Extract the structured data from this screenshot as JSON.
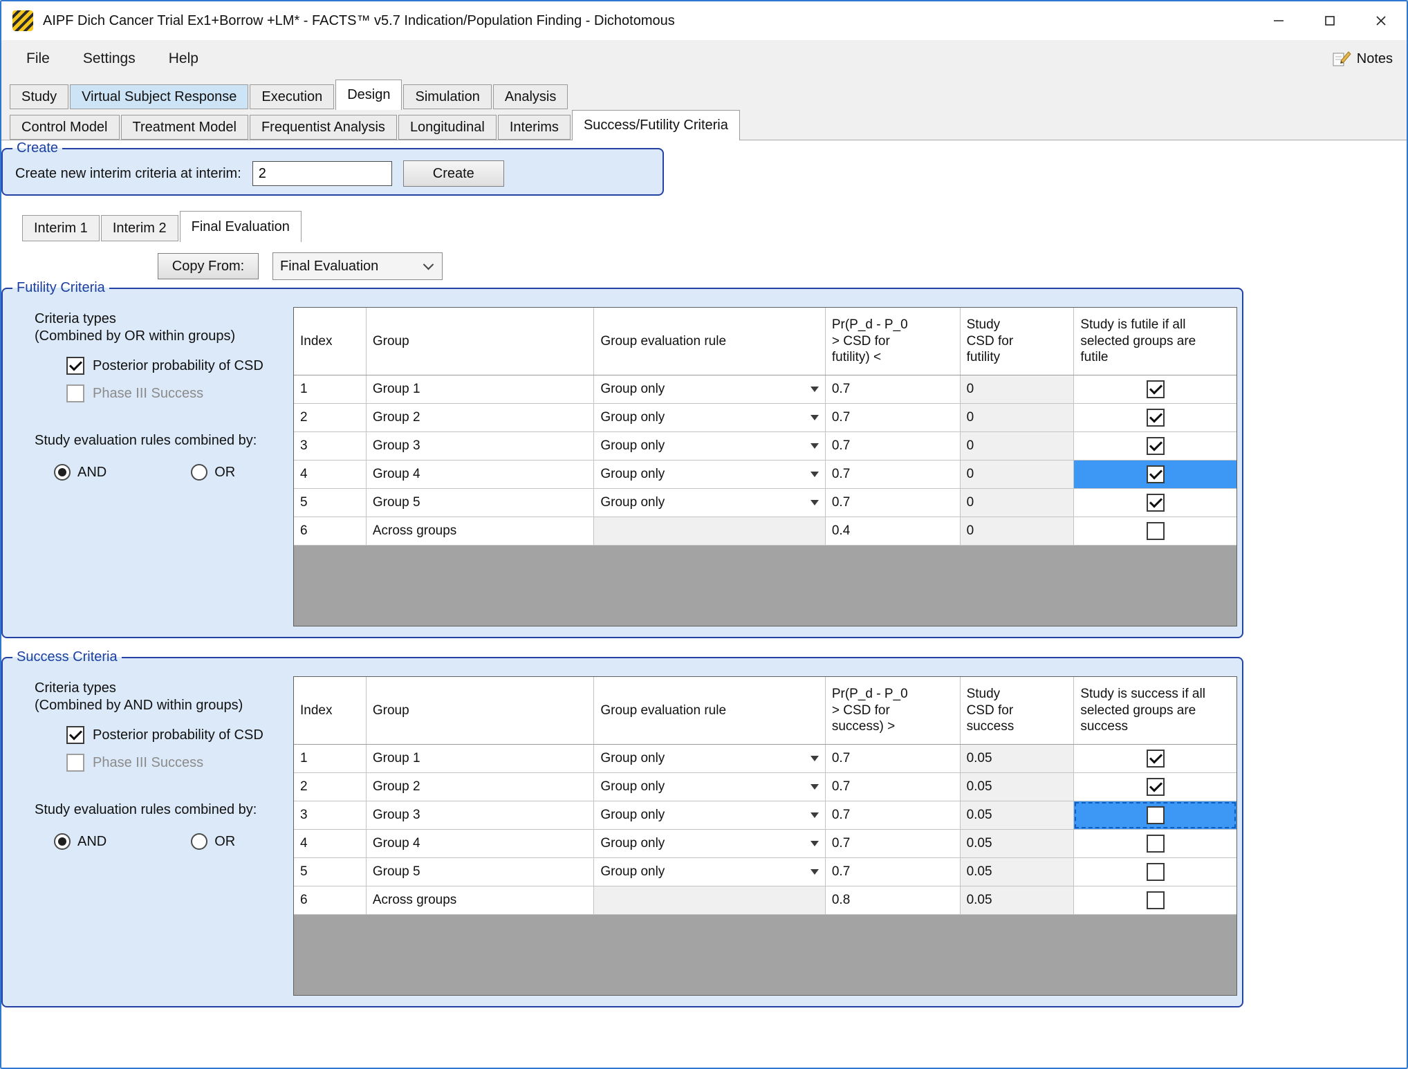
{
  "colors": {
    "window_border": "#2f77d1",
    "groupbox_border": "#2442a4",
    "groupbox_bg": "#dce9f8",
    "legend_text": "#1b3f9e",
    "highlight_blue": "#3d97f5",
    "tab_highlight_bg": "#cde4f7",
    "grid_filler": "#a3a3a3"
  },
  "window": {
    "title": "AIPF Dich Cancer Trial Ex1+Borrow +LM* - FACTS™ v5.7 Indication/Population Finding - Dichotomous"
  },
  "menu": {
    "items": [
      {
        "label": "File"
      },
      {
        "label": "Settings"
      },
      {
        "label": "Help"
      }
    ],
    "notes_label": "Notes"
  },
  "main_tabs": [
    {
      "label": "Study"
    },
    {
      "label": "Virtual Subject Response",
      "highlight": true
    },
    {
      "label": "Execution"
    },
    {
      "label": "Design",
      "selected": true
    },
    {
      "label": "Simulation"
    },
    {
      "label": "Analysis"
    }
  ],
  "design_tabs": [
    {
      "label": "Control Model"
    },
    {
      "label": "Treatment Model"
    },
    {
      "label": "Frequentist Analysis"
    },
    {
      "label": "Longitudinal"
    },
    {
      "label": "Interims"
    },
    {
      "label": "Success/Futility Criteria",
      "selected": true
    }
  ],
  "create": {
    "legend": "Create",
    "label": "Create new interim criteria at interim:",
    "value": "2",
    "button_label": "Create"
  },
  "interim_tabs": [
    {
      "label": "Interim 1"
    },
    {
      "label": "Interim 2"
    },
    {
      "label": "Final Evaluation",
      "selected": true
    }
  ],
  "copy_from": {
    "button_label": "Copy From:",
    "value": "Final Evaluation"
  },
  "futility": {
    "legend": "Futility Criteria",
    "criteria_types_title": "Criteria types",
    "criteria_types_note": "(Combined by OR within groups)",
    "checkbox_posterior": {
      "label": "Posterior probability of CSD",
      "checked": true
    },
    "checkbox_phase3": {
      "label": "Phase III Success",
      "checked": false,
      "disabled": true
    },
    "rules_label": "Study evaluation rules combined by:",
    "radio_and": {
      "label": "AND",
      "selected": true
    },
    "radio_or": {
      "label": "OR",
      "selected": false
    },
    "table": {
      "headers": [
        "Index",
        "Group",
        "Group evaluation rule",
        "Pr(P_d - P_0\n> CSD for\nfutility) <",
        "Study\nCSD for\nfutility",
        "Study is futile if all\nselected groups are\nfutile"
      ],
      "rows": [
        {
          "index": "1",
          "group": "Group 1",
          "rule": "Group only",
          "has_dropdown": true,
          "pr": "0.7",
          "csd": "0",
          "checked": true
        },
        {
          "index": "2",
          "group": "Group 2",
          "rule": "Group only",
          "has_dropdown": true,
          "pr": "0.7",
          "csd": "0",
          "checked": true
        },
        {
          "index": "3",
          "group": "Group 3",
          "rule": "Group only",
          "has_dropdown": true,
          "pr": "0.7",
          "csd": "0",
          "checked": true
        },
        {
          "index": "4",
          "group": "Group 4",
          "rule": "Group only",
          "has_dropdown": true,
          "pr": "0.7",
          "csd": "0",
          "checked": true,
          "checkbox_cell_highlighted": true
        },
        {
          "index": "5",
          "group": "Group 5",
          "rule": "Group only",
          "has_dropdown": true,
          "pr": "0.7",
          "csd": "0",
          "checked": true
        },
        {
          "index": "6",
          "group": "Across groups",
          "rule": "",
          "has_dropdown": false,
          "pr": "0.4",
          "csd": "0",
          "checked": false
        }
      ]
    }
  },
  "success": {
    "legend": "Success Criteria",
    "criteria_types_title": "Criteria types",
    "criteria_types_note": "(Combined by AND within groups)",
    "checkbox_posterior": {
      "label": "Posterior probability of CSD",
      "checked": true
    },
    "checkbox_phase3": {
      "label": "Phase III Success",
      "checked": false,
      "disabled": true
    },
    "rules_label": "Study evaluation rules combined by:",
    "radio_and": {
      "label": "AND",
      "selected": true
    },
    "radio_or": {
      "label": "OR",
      "selected": false
    },
    "table": {
      "headers": [
        "Index",
        "Group",
        "Group evaluation rule",
        "Pr(P_d - P_0\n> CSD for\nsuccess) >",
        "Study\nCSD for\nsuccess",
        "Study is success if all\nselected groups are\nsuccess"
      ],
      "rows": [
        {
          "index": "1",
          "group": "Group 1",
          "rule": "Group only",
          "has_dropdown": true,
          "pr": "0.7",
          "csd": "0.05",
          "checked": true
        },
        {
          "index": "2",
          "group": "Group 2",
          "rule": "Group only",
          "has_dropdown": true,
          "pr": "0.7",
          "csd": "0.05",
          "checked": true
        },
        {
          "index": "3",
          "group": "Group 3",
          "rule": "Group only",
          "has_dropdown": true,
          "pr": "0.7",
          "csd": "0.05",
          "checked": false,
          "checkbox_cell_highlighted": true,
          "checkbox_cell_focused": true
        },
        {
          "index": "4",
          "group": "Group 4",
          "rule": "Group only",
          "has_dropdown": true,
          "pr": "0.7",
          "csd": "0.05",
          "checked": false
        },
        {
          "index": "5",
          "group": "Group 5",
          "rule": "Group only",
          "has_dropdown": true,
          "pr": "0.7",
          "csd": "0.05",
          "checked": false
        },
        {
          "index": "6",
          "group": "Across groups",
          "rule": "",
          "has_dropdown": false,
          "pr": "0.8",
          "csd": "0.05",
          "checked": false
        }
      ]
    }
  }
}
